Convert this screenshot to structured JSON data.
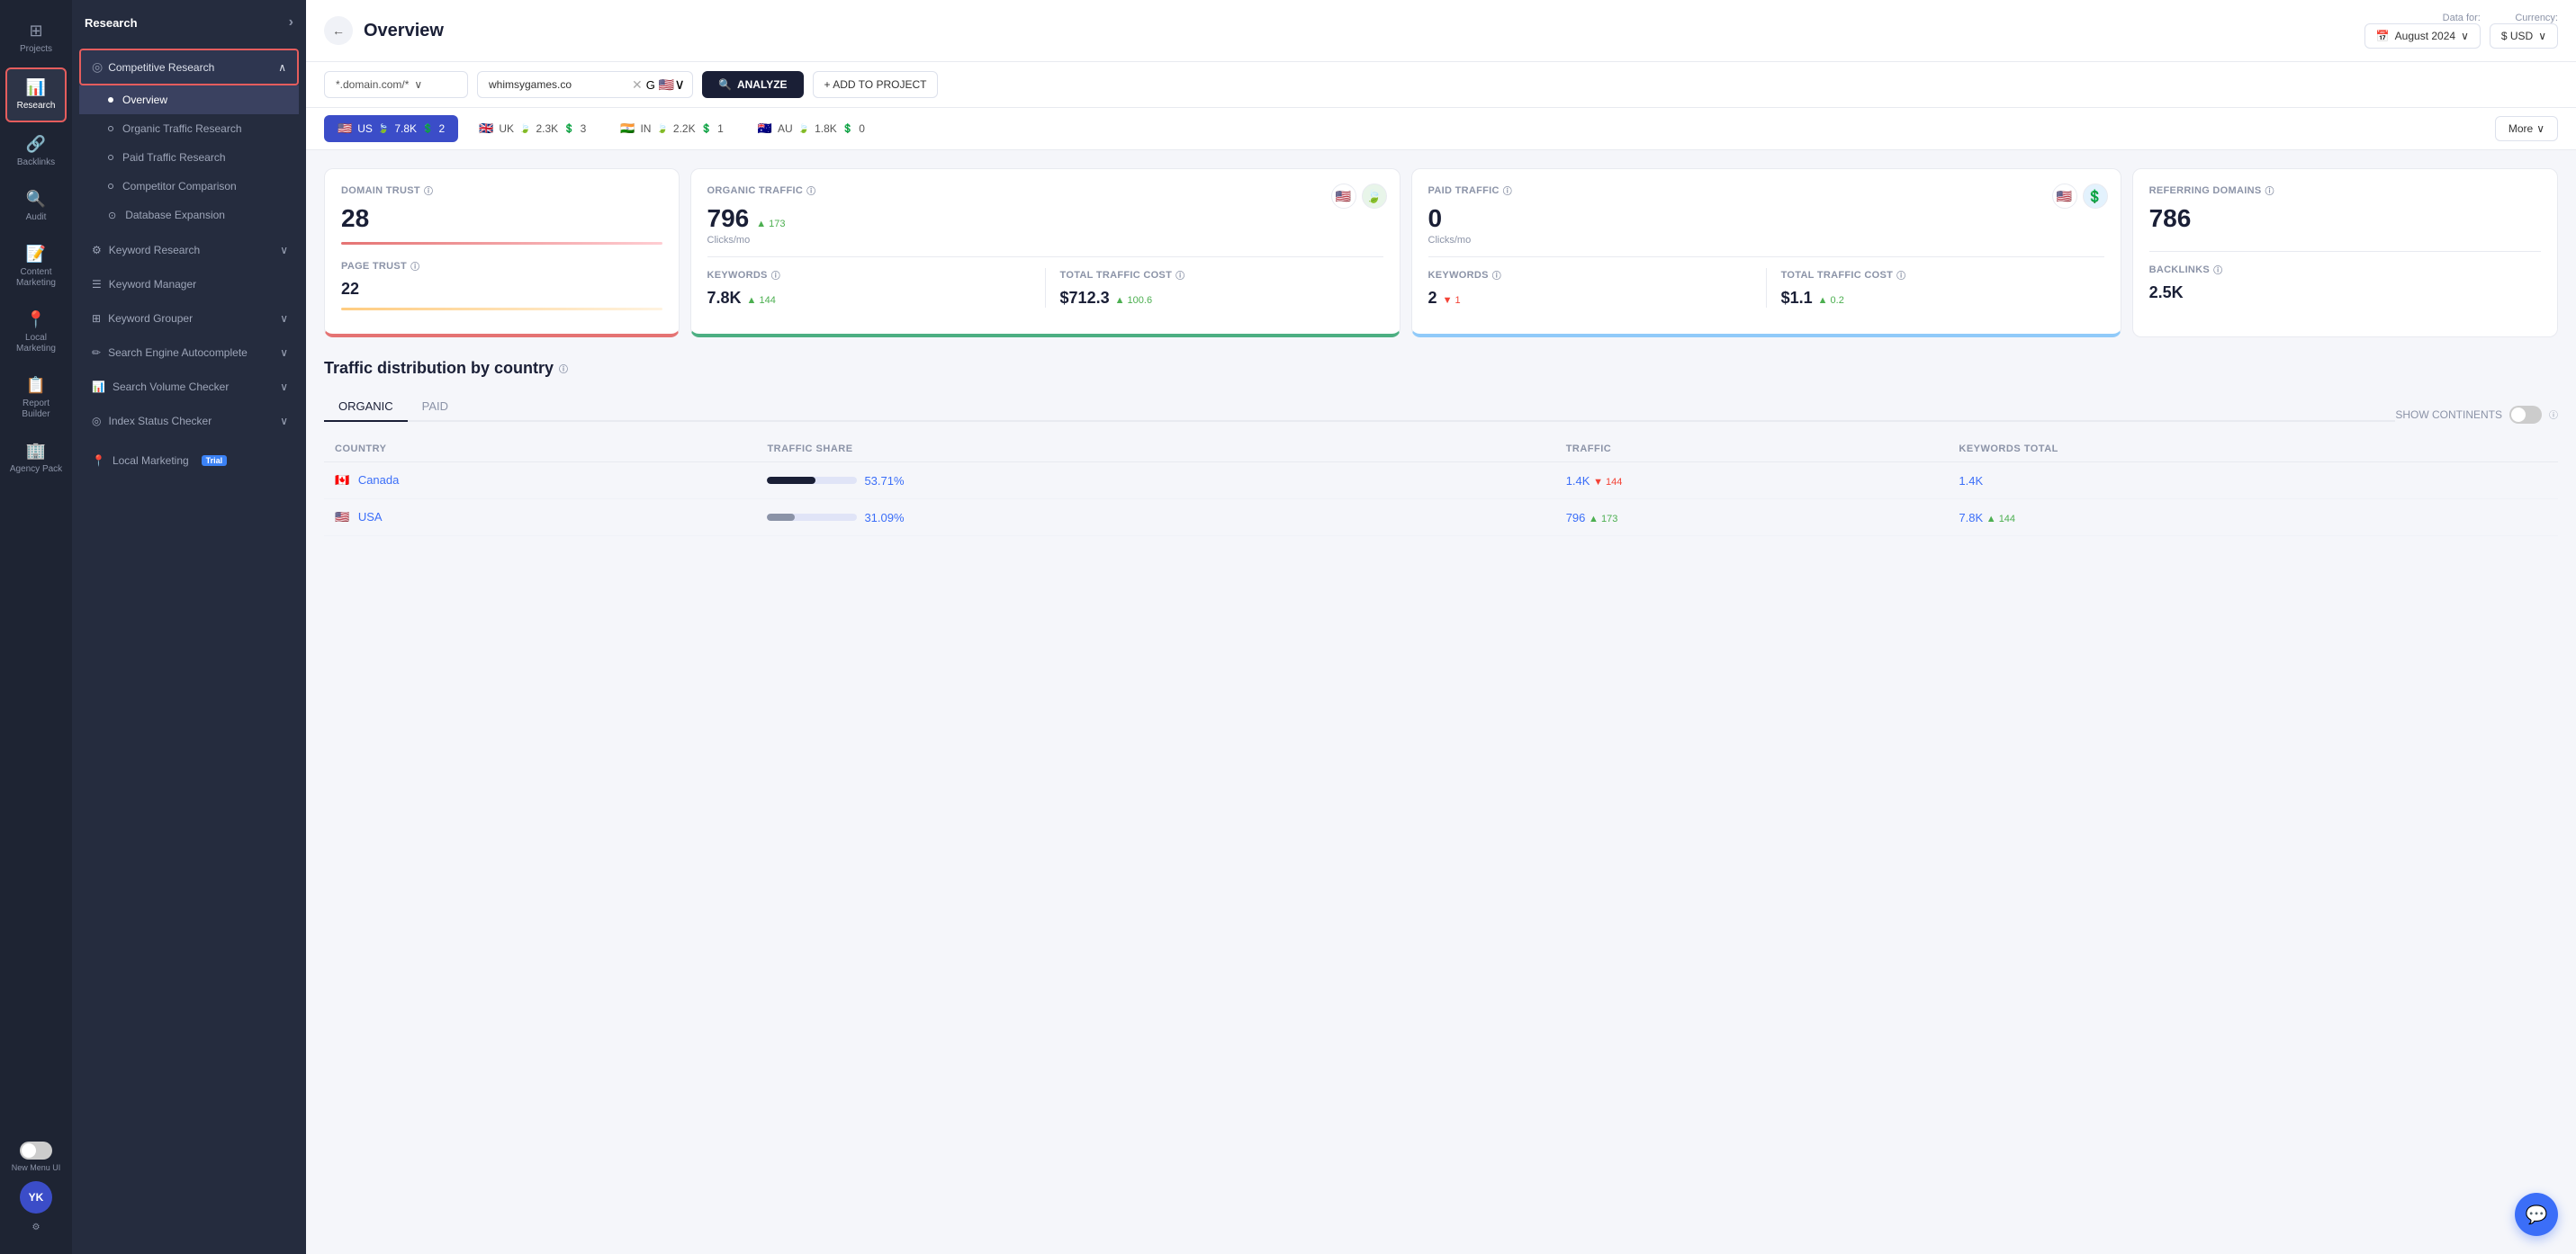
{
  "leftNav": {
    "items": [
      {
        "id": "projects",
        "label": "Projects",
        "icon": "⊞",
        "active": false
      },
      {
        "id": "research",
        "label": "Research",
        "icon": "📊",
        "active": true
      },
      {
        "id": "backlinks",
        "label": "Backlinks",
        "icon": "🔗",
        "active": false
      },
      {
        "id": "audit",
        "label": "Audit",
        "icon": "🔍",
        "active": false
      },
      {
        "id": "content",
        "label": "Content Marketing",
        "icon": "📝",
        "active": false
      },
      {
        "id": "local",
        "label": "Local Marketing",
        "icon": "📍",
        "active": false
      },
      {
        "id": "report",
        "label": "Report Builder",
        "icon": "📋",
        "active": false
      },
      {
        "id": "agency",
        "label": "Agency Pack",
        "icon": "🏢",
        "active": false
      }
    ]
  },
  "sidebar": {
    "title": "Research",
    "sections": [
      {
        "id": "competitive",
        "icon": "◎",
        "label": "Competitive Research",
        "expanded": true,
        "items": [
          {
            "id": "overview",
            "label": "Overview",
            "active": true,
            "bullet": "filled"
          },
          {
            "id": "organic",
            "label": "Organic Traffic Research",
            "active": false,
            "bullet": "hollow"
          },
          {
            "id": "paid",
            "label": "Paid Traffic Research",
            "active": false,
            "bullet": "hollow"
          },
          {
            "id": "competitor",
            "label": "Competitor Comparison",
            "active": false,
            "bullet": "hollow"
          },
          {
            "id": "database",
            "label": "Database Expansion",
            "active": false,
            "bullet": "hollow"
          }
        ]
      }
    ],
    "standalone": [
      {
        "id": "keyword-research",
        "icon": "⚙",
        "label": "Keyword Research",
        "hasArrow": true,
        "badge": null
      },
      {
        "id": "keyword-manager",
        "icon": "☰",
        "label": "Keyword Manager",
        "hasArrow": false,
        "badge": null
      },
      {
        "id": "keyword-grouper",
        "icon": "⊞",
        "label": "Keyword Grouper",
        "hasArrow": true,
        "badge": null
      },
      {
        "id": "search-autocomplete",
        "icon": "✏",
        "label": "Search Engine Autocomplete",
        "hasArrow": true,
        "badge": null
      },
      {
        "id": "search-volume",
        "icon": "📊",
        "label": "Search Volume Checker",
        "hasArrow": true,
        "badge": null
      },
      {
        "id": "index-status",
        "icon": "◎",
        "label": "Index Status Checker",
        "hasArrow": true,
        "badge": null
      }
    ],
    "trial": {
      "id": "local-marketing",
      "icon": "📍",
      "label": "Local Marketing",
      "badge": "Trial"
    }
  },
  "header": {
    "backButton": "←",
    "title": "Overview",
    "dataForLabel": "Data for:",
    "dateValue": "August 2024",
    "currencyLabel": "Currency:",
    "currencyValue": "$ USD"
  },
  "filterBar": {
    "domainFilter": "*.domain.com/*",
    "domainPlaceholder": "*.domain.com/*",
    "searchValue": "whimsygames.co",
    "analyzeLabel": "ANALYZE",
    "addToProjectLabel": "+ ADD TO PROJECT"
  },
  "countryTabs": [
    {
      "id": "us",
      "flag": "🇺🇸",
      "code": "US",
      "traffic": "7.8K",
      "paid": "2",
      "active": true
    },
    {
      "id": "uk",
      "flag": "🇬🇧",
      "code": "UK",
      "traffic": "2.3K",
      "paid": "3",
      "active": false
    },
    {
      "id": "in",
      "flag": "🇮🇳",
      "code": "IN",
      "traffic": "2.2K",
      "paid": "1",
      "active": false
    },
    {
      "id": "au",
      "flag": "🇦🇺",
      "code": "AU",
      "traffic": "1.8K",
      "paid": "0",
      "active": false
    }
  ],
  "moreButton": "More",
  "metrics": {
    "domainTrust": {
      "label": "DOMAIN TRUST",
      "value": "28",
      "subLabel": "PAGE TRUST",
      "subValue": "22"
    },
    "organic": {
      "label": "ORGANIC TRAFFIC",
      "value": "796",
      "trend": "▲ 173",
      "trendType": "up",
      "subLabel": "Clicks/mo",
      "keywords": {
        "label": "KEYWORDS",
        "value": "7.8K",
        "trend": "▲ 144",
        "trendType": "up"
      },
      "trafficCost": {
        "label": "TOTAL TRAFFIC COST",
        "value": "$712.3",
        "trend": "▲ 100.6",
        "trendType": "up"
      }
    },
    "paid": {
      "label": "PAID TRAFFIC",
      "value": "0",
      "subLabel": "Clicks/mo",
      "keywords": {
        "label": "KEYWORDS",
        "value": "2",
        "trend": "▼ 1",
        "trendType": "down"
      },
      "trafficCost": {
        "label": "TOTAL TRAFFIC COST",
        "value": "$1.1",
        "trend": "▲ 0.2",
        "trendType": "up"
      }
    },
    "referring": {
      "label": "REFERRING DOMAINS",
      "value": "786",
      "backlinksLabel": "BACKLINKS",
      "backlinksValue": "2.5K"
    }
  },
  "trafficSection": {
    "title": "Traffic distribution by country",
    "tabs": [
      {
        "id": "organic",
        "label": "ORGANIC",
        "active": true
      },
      {
        "id": "paid",
        "label": "PAID",
        "active": false
      }
    ],
    "showContinentsLabel": "SHOW CONTINENTS",
    "toggleState": "off",
    "tableHeaders": [
      {
        "id": "country",
        "label": "COUNTRY"
      },
      {
        "id": "trafficShare",
        "label": "TRAFFIC SHARE"
      },
      {
        "id": "traffic",
        "label": "TRAFFIC"
      },
      {
        "id": "keywordsTotal",
        "label": "KEYWORDS TOTAL"
      }
    ],
    "rows": [
      {
        "flag": "🇨🇦",
        "country": "Canada",
        "trafficShare": "53.71%",
        "barWidth": 54,
        "barType": "dark",
        "traffic": "1.4K",
        "trafficTrend": "▼ 144",
        "trafficTrendType": "down",
        "keywords": "1.4K"
      },
      {
        "flag": "🇺🇸",
        "country": "USA",
        "trafficShare": "31.09%",
        "barWidth": 31,
        "barType": "gray",
        "traffic": "796",
        "trafficTrend": "▲ 173",
        "trafficTrendType": "up",
        "keywords": "7.8K ▲ 144"
      }
    ]
  },
  "newMenuUI": {
    "label": "New Menu UI"
  },
  "userInitials": "YK",
  "infoIcon": "ⓘ"
}
